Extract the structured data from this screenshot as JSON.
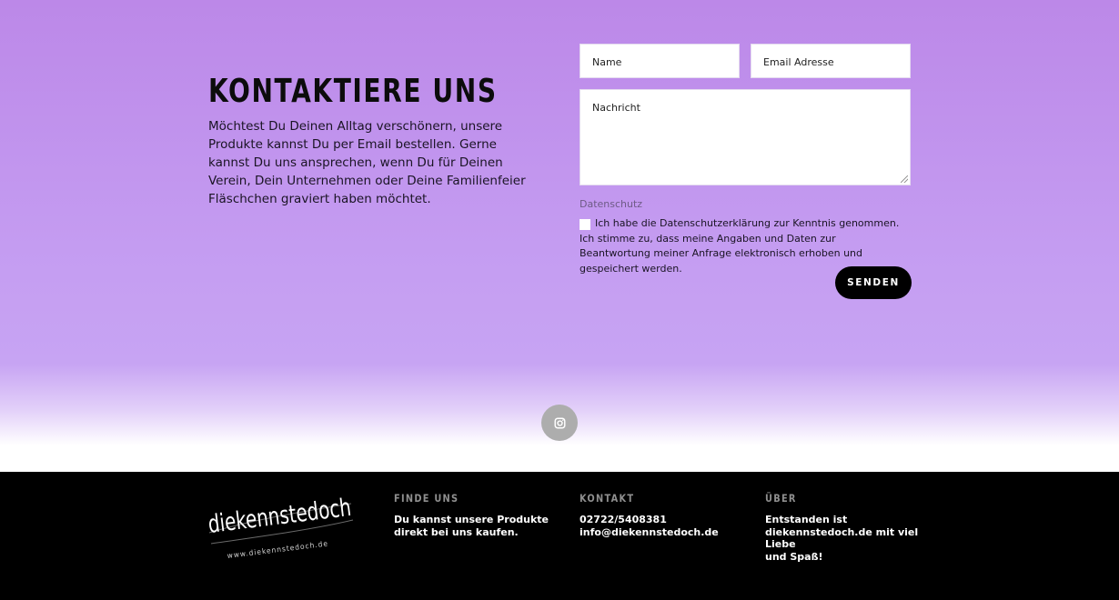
{
  "contact": {
    "title": "KONTAKTIERE UNS",
    "text": "Möchtest Du Deinen Alltag verschönern, unsere Produkte kannst Du per Email bestellen. Gerne kannst Du uns ansprechen, wenn Du für Deinen Verein, Dein Unternehmen oder Deine Familienfeier Fläschchen graviert haben möchtet."
  },
  "form": {
    "name_placeholder": "Name",
    "email_placeholder": "Email Adresse",
    "message_placeholder": "Nachricht",
    "privacy_heading": "Datenschutz",
    "privacy_text": "Ich habe die Datenschutzerklärung zur Kenntnis genommen. Ich stimme zu, dass meine Angaben und Daten zur Beantwortung meiner Anfrage elektronisch erhoben und gespeichert werden.",
    "privacy_checked": false,
    "send_label": "SENDEN"
  },
  "social": {
    "icon": "instagram-icon"
  },
  "footer": {
    "logo_text": "diekennstedoch",
    "logo_url_text": "www.diekennstedoch.de",
    "columns": [
      {
        "heading": "FINDE UNS",
        "lines": [
          "Du kannst unsere Produkte",
          "direkt bei uns kaufen."
        ]
      },
      {
        "heading": "KONTAKT",
        "lines": [
          "02722/5408381",
          "info@diekennstedoch.de"
        ]
      },
      {
        "heading": "ÜBER",
        "lines": [
          "Entstanden ist",
          "diekennstedoch.de mit viel Liebe",
          "und Spaß!"
        ]
      }
    ]
  },
  "colors": {
    "hero_top": "#bc88e8",
    "hero_mid": "#c7a4f3",
    "button": "#000000",
    "footer_bg": "#000000",
    "footer_heading": "#8f8f8f",
    "social_button": "#adadad"
  }
}
